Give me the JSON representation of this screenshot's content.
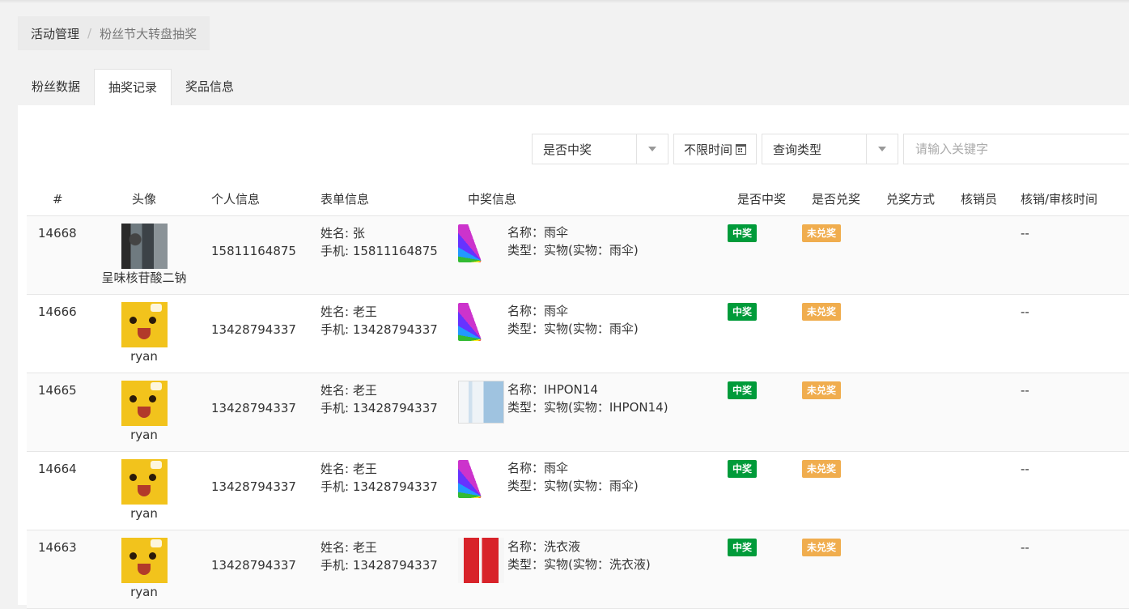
{
  "breadcrumb": {
    "home": "活动管理",
    "separator": "/",
    "current": "粉丝节大转盘抽奖"
  },
  "tabs": [
    {
      "label": "粉丝数据",
      "active": false
    },
    {
      "label": "抽奖记录",
      "active": true
    },
    {
      "label": "奖品信息",
      "active": false
    }
  ],
  "filters": {
    "win_select": "是否中奖",
    "time_label": "不限时间",
    "query_type_select": "查询类型",
    "keyword_placeholder": "请输入关键字"
  },
  "columns": [
    "#",
    "头像",
    "个人信息",
    "表单信息",
    "中奖信息",
    "是否中奖",
    "是否兑奖",
    "兑奖方式",
    "核销员",
    "核销/审核时间"
  ],
  "rows": [
    {
      "id": "14668",
      "avatar": "photo",
      "nickname": "呈味核苷酸二钠",
      "phone": "15811164875",
      "form_name": "姓名: 张",
      "form_phone": "手机: 15811164875",
      "prize_image": "umbrella",
      "prize_name": "名称：雨伞",
      "prize_type": "类型：实物(实物：雨伞)",
      "win": "中奖",
      "redeem": "未兑奖",
      "redeem_method": "",
      "verifier": "",
      "verify_time": "--"
    },
    {
      "id": "14666",
      "avatar": "pikachu",
      "nickname": "ryan",
      "phone": "13428794337",
      "form_name": "姓名: 老王",
      "form_phone": "手机: 13428794337",
      "prize_image": "umbrella",
      "prize_name": "名称：雨伞",
      "prize_type": "类型：实物(实物：雨伞)",
      "win": "中奖",
      "redeem": "未兑奖",
      "redeem_method": "",
      "verifier": "",
      "verify_time": "--"
    },
    {
      "id": "14665",
      "avatar": "pikachu",
      "nickname": "ryan",
      "phone": "13428794337",
      "form_name": "姓名: 老王",
      "form_phone": "手机: 13428794337",
      "prize_image": "phone",
      "prize_name": "名称：IHPON14",
      "prize_type": "类型：实物(实物：IHPON14)",
      "win": "中奖",
      "redeem": "未兑奖",
      "redeem_method": "",
      "verifier": "",
      "verify_time": "--"
    },
    {
      "id": "14664",
      "avatar": "pikachu",
      "nickname": "ryan",
      "phone": "13428794337",
      "form_name": "姓名: 老王",
      "form_phone": "手机: 13428794337",
      "prize_image": "umbrella",
      "prize_name": "名称：雨伞",
      "prize_type": "类型：实物(实物：雨伞)",
      "win": "中奖",
      "redeem": "未兑奖",
      "redeem_method": "",
      "verifier": "",
      "verify_time": "--"
    },
    {
      "id": "14663",
      "avatar": "pikachu",
      "nickname": "ryan",
      "phone": "13428794337",
      "form_name": "姓名: 老王",
      "form_phone": "手机: 13428794337",
      "prize_image": "detergent",
      "prize_name": "名称：洗衣液",
      "prize_type": "类型：实物(实物：洗衣液)",
      "win": "中奖",
      "redeem": "未兑奖",
      "redeem_method": "",
      "verifier": "",
      "verify_time": "--"
    }
  ],
  "colors": {
    "win_badge": "#009b3a",
    "unredeemed_badge": "#f0ad4e"
  }
}
